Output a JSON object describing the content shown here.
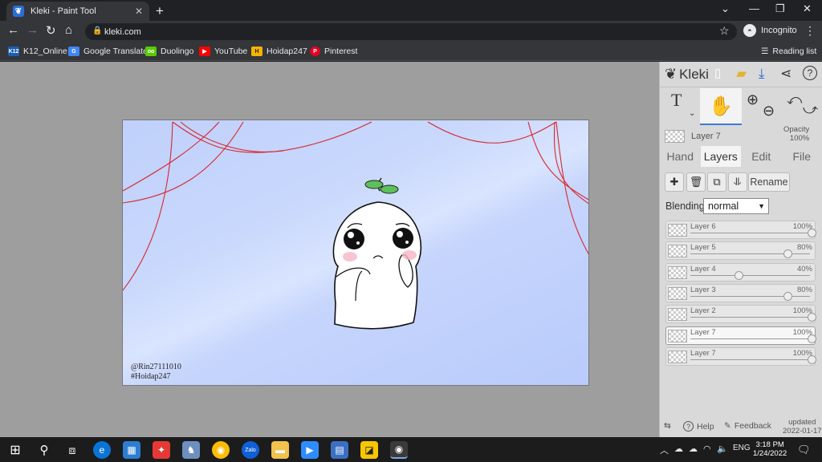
{
  "browser": {
    "tab_title": "Kleki - Paint Tool",
    "tab_favicon": "kleki-logo-icon",
    "new_tab": "+",
    "url": "kleki.com",
    "profile_label": "Incognito",
    "bookmarks": [
      {
        "label": "K12_Online",
        "icon": "K12",
        "color": "#1a5fb4"
      },
      {
        "label": "Google Translate",
        "icon": "G",
        "color": "#4285f4"
      },
      {
        "label": "Duolingo",
        "icon": "oo",
        "color": "#58cc02"
      },
      {
        "label": "YouTube",
        "icon": "▶",
        "color": "#ff0000"
      },
      {
        "label": "Hoidap247",
        "icon": "H",
        "color": "#f4b400"
      },
      {
        "label": "Pinterest",
        "icon": "P",
        "color": "#e60023"
      }
    ],
    "reading_list": "Reading list"
  },
  "canvas": {
    "signature_line1": "@Rin27111010",
    "signature_line2": "#Hoidap247"
  },
  "panel": {
    "logo": "Kleki",
    "current_layer": "Layer 7",
    "opacity_label": "Opacity",
    "opacity_value": "100%",
    "tabs": [
      {
        "label": "Hand",
        "active": false
      },
      {
        "label": "Layers",
        "active": true
      },
      {
        "label": "Edit",
        "active": false
      },
      {
        "label": "File",
        "active": false
      }
    ],
    "rename_label": "Rename",
    "blending_label": "Blending",
    "blending_value": "normal",
    "layers": [
      {
        "name": "Layer 6",
        "opacity": "100%",
        "fraction": 1.0,
        "selected": false
      },
      {
        "name": "Layer 5",
        "opacity": "80%",
        "fraction": 0.8,
        "selected": false
      },
      {
        "name": "Layer 4",
        "opacity": "40%",
        "fraction": 0.4,
        "selected": false
      },
      {
        "name": "Layer 3",
        "opacity": "80%",
        "fraction": 0.8,
        "selected": false
      },
      {
        "name": "Layer 2",
        "opacity": "100%",
        "fraction": 1.0,
        "selected": false
      },
      {
        "name": "Layer 7",
        "opacity": "100%",
        "fraction": 1.0,
        "selected": true
      },
      {
        "name": "Layer 7",
        "opacity": "100%",
        "fraction": 1.0,
        "selected": false
      }
    ],
    "help_label": "Help",
    "feedback_label": "Feedback",
    "updated_label": "updated",
    "updated_date": "2022-01-17"
  },
  "taskbar": {
    "language": "ENG",
    "time": "3:18 PM",
    "date": "1/24/2022"
  }
}
